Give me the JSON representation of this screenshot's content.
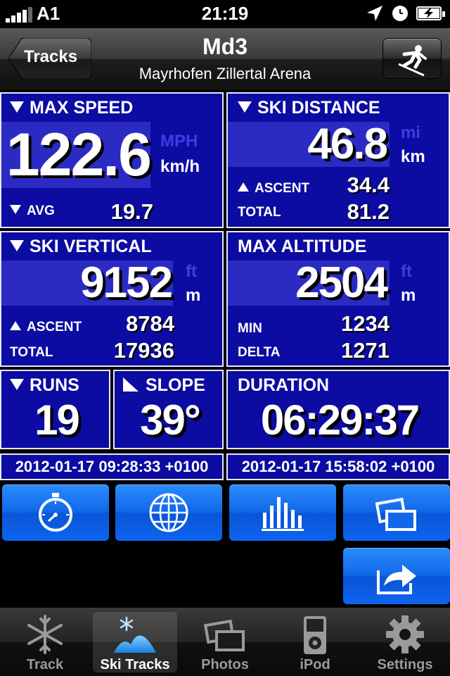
{
  "status_bar": {
    "carrier": "A1",
    "time": "21:19",
    "icons": [
      "signal-icon",
      "location-arrow-icon",
      "alarm-clock-icon",
      "battery-charging-icon"
    ]
  },
  "nav": {
    "back_label": "Tracks",
    "title": "Md3",
    "subtitle": "Mayrhofen Zillertal Arena",
    "right_button_icon": "skier-icon"
  },
  "stats": {
    "max_speed": {
      "label": "MAX SPEED",
      "value": "122.6",
      "unit_inactive": "MPH",
      "unit_active": "km/h",
      "avg_label": "AVG",
      "avg_value": "19.7"
    },
    "ski_distance": {
      "label": "SKI DISTANCE",
      "value": "46.8",
      "unit_inactive": "mi",
      "unit_active": "km",
      "ascent_label": "ASCENT",
      "ascent_value": "34.4",
      "total_label": "TOTAL",
      "total_value": "81.2"
    },
    "ski_vertical": {
      "label": "SKI VERTICAL",
      "value": "9152",
      "unit_inactive": "ft",
      "unit_active": "m",
      "ascent_label": "ASCENT",
      "ascent_value": "8784",
      "total_label": "TOTAL",
      "total_value": "17936"
    },
    "max_altitude": {
      "label": "MAX ALTITUDE",
      "value": "2504",
      "unit_inactive": "ft",
      "unit_active": "m",
      "min_label": "MIN",
      "min_value": "1234",
      "delta_label": "DELTA",
      "delta_value": "1271"
    },
    "runs": {
      "label": "RUNS",
      "value": "19"
    },
    "slope": {
      "label": "SLOPE",
      "value": "39°"
    },
    "duration": {
      "label": "DURATION",
      "value": "06:29:37"
    }
  },
  "times": {
    "start": "2012-01-17 09:28:33 +0100",
    "end": "2012-01-17 15:58:02 +0100"
  },
  "actions": [
    {
      "icon": "stopwatch-icon"
    },
    {
      "icon": "globe-icon"
    },
    {
      "icon": "bar-chart-icon"
    },
    {
      "icon": "photos-icon"
    },
    {
      "icon": "share-arrow-icon"
    }
  ],
  "tabbar": {
    "tabs": [
      {
        "label": "Track",
        "icon": "snowflake-icon",
        "selected": false
      },
      {
        "label": "Ski Tracks",
        "icon": "ski-tracks-mountain-icon",
        "selected": true
      },
      {
        "label": "Photos",
        "icon": "photos-icon",
        "selected": false
      },
      {
        "label": "iPod",
        "icon": "ipod-icon",
        "selected": false
      },
      {
        "label": "Settings",
        "icon": "gear-icon",
        "selected": false
      }
    ]
  },
  "colors": {
    "panel_blue": "#0c0ca2",
    "band_blue": "#2b2bc4",
    "button_blue": "#1268e8",
    "inactive_unit": "#3d3de0"
  }
}
